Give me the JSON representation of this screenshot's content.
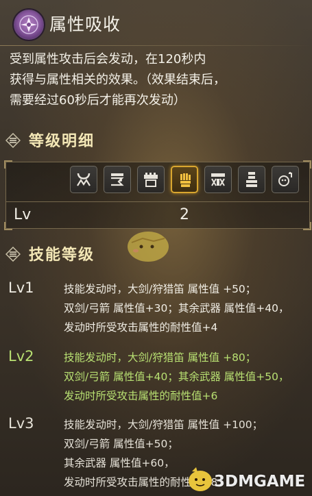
{
  "skill": {
    "title": "属性吸收",
    "icon": "element-absorb-icon",
    "description": [
      "受到属性攻击后会发动，在120秒内",
      "获得与属性相关的效果。（效果结束后，",
      "需要经过60秒后才能再次发动）"
    ]
  },
  "level_detail": {
    "heading": "等级明细",
    "weapons": [
      {
        "icon": "hunting-horn-icon",
        "active": false
      },
      {
        "icon": "insect-glaive-icon",
        "active": false
      },
      {
        "icon": "gunlance-icon",
        "active": false
      },
      {
        "icon": "gauntlet-icon",
        "active": true
      },
      {
        "icon": "heavy-bowgun-icon",
        "active": false
      },
      {
        "icon": "lance-icon",
        "active": false
      },
      {
        "icon": "palico-gadget-icon",
        "active": false
      }
    ],
    "lv_label": "Lv",
    "lv_value": "2"
  },
  "skill_levels": {
    "heading": "技能等级",
    "levels": [
      {
        "name": "Lv1",
        "lines": [
          "技能发动时，大剑/狩猎笛 属性值 +50；",
          "双剑/弓箭 属性值+30；其余武器 属性值+40，",
          "发动时所受攻击属性的耐性值+4"
        ],
        "state": "normal"
      },
      {
        "name": "Lv2",
        "lines": [
          "技能发动时，大剑/狩猎笛 属性值 +80；",
          "双剑/弓箭 属性值+40；其余武器 属性值+50，",
          "发动时所受攻击属性的耐性值+6"
        ],
        "state": "current"
      },
      {
        "name": "Lv3",
        "lines": [
          "技能发动时，大剑/狩猎笛 属性值 +100；",
          "双剑/弓箭 属性值+50；",
          "其余武器 属性值+60，",
          "发动时所受攻击属性的耐性值+8"
        ],
        "state": "normal"
      }
    ]
  },
  "watermark": {
    "text": "3DMGAME"
  },
  "colors": {
    "current_level": "#b8e072",
    "heading": "#f3e7b6",
    "active_weapon_border": "#d9a62f"
  }
}
